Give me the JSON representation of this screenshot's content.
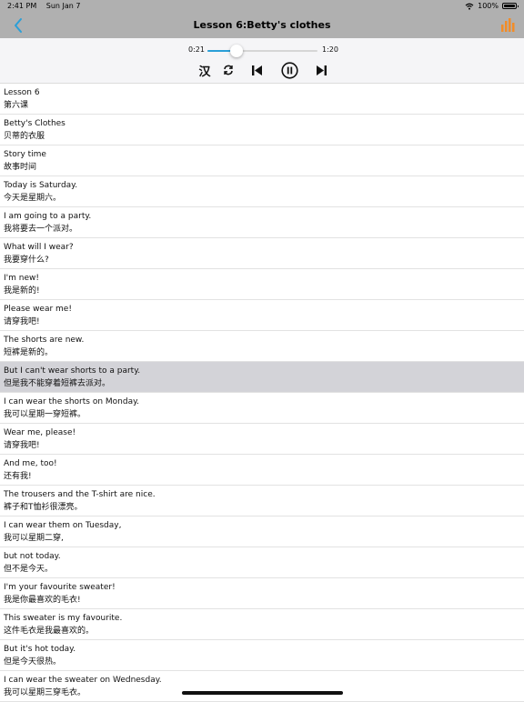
{
  "status": {
    "time": "2:41 PM",
    "date": "Sun Jan 7",
    "battery": "100%"
  },
  "nav": {
    "title": "Lesson 6:Betty's clothes",
    "back_icon": "chevron-left-icon",
    "chart_icon": "bar-chart-icon"
  },
  "player": {
    "current": "0:21",
    "total": "1:20",
    "progress": 0.2625,
    "han_label": "汉",
    "accent": "#2a9fd8"
  },
  "colors": {
    "back": "#2a9fd8",
    "chart": "#f28c28",
    "selected_row": "#d3d3d8"
  },
  "lines": [
    {
      "en": "Lesson 6",
      "zh": "第六课"
    },
    {
      "en": "Betty's Clothes",
      "zh": "贝蒂的衣服"
    },
    {
      "en": "Story time",
      "zh": "故事时间"
    },
    {
      "en": "Today is Saturday.",
      "zh": "今天是星期六。"
    },
    {
      "en": "I am going to a party.",
      "zh": "我将要去一个派对。"
    },
    {
      "en": "What will I wear?",
      "zh": "我要穿什么?"
    },
    {
      "en": "I'm new!",
      "zh": "我是新的!"
    },
    {
      "en": "Please wear me!",
      "zh": "请穿我吧!"
    },
    {
      "en": "The shorts are new.",
      "zh": "短裤是新的。"
    },
    {
      "en": "But I can't wear shorts to a party.",
      "zh": "但是我不能穿着短裤去派对。"
    },
    {
      "en": "I can wear the shorts on Monday.",
      "zh": "我可以星期一穿短裤。"
    },
    {
      "en": "Wear me, please!",
      "zh": "请穿我吧!"
    },
    {
      "en": "And me, too!",
      "zh": "还有我!"
    },
    {
      "en": "The trousers and the T-shirt are nice.",
      "zh": "裤子和T恤衫很漂亮。"
    },
    {
      "en": "I can wear them on Tuesday,",
      "zh": "我可以星期二穿,"
    },
    {
      "en": "but not today.",
      "zh": "但不是今天。"
    },
    {
      "en": "I'm your favourite sweater!",
      "zh": "我是你最喜欢的毛衣!"
    },
    {
      "en": "This sweater is my favourite.",
      "zh": "这件毛衣是我最喜欢的。"
    },
    {
      "en": "But it's hot today.",
      "zh": "但是今天很热。"
    },
    {
      "en": "I can wear the sweater on Wednesday.",
      "zh": "我可以星期三穿毛衣。"
    }
  ],
  "selected_index": 9
}
